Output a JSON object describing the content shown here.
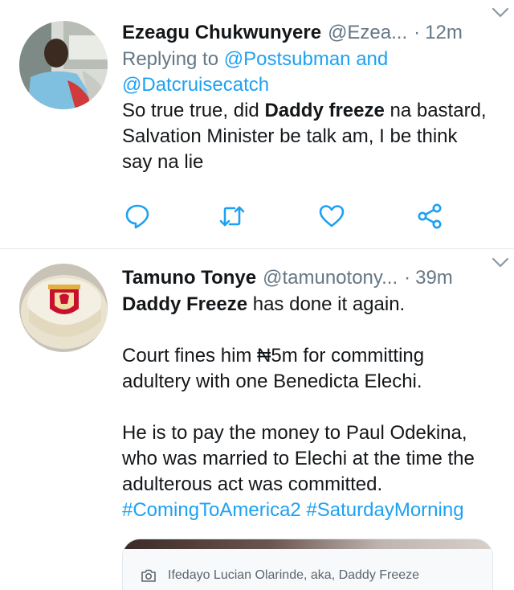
{
  "tweets": [
    {
      "name": "Ezeagu Chukwunyere",
      "handle": "@Ezea...",
      "time": "12m",
      "replying_prefix": "Replying to ",
      "replying_to_1": "@Postsubman and",
      "replying_to_2": "@Datcruisecatch",
      "text_parts": [
        "So true true, did ",
        "Daddy freeze",
        " na bastard,",
        "Salvation Minister be talk am, I be think",
        "say na lie"
      ],
      "actions": [
        "reply-icon",
        "retweet-icon",
        "like-icon",
        "share-icon"
      ]
    },
    {
      "name": "Tamuno Tonye",
      "handle": "@tamunotony...",
      "time": "39m",
      "p1_bold": "Daddy Freeze",
      "p1_rest": " has done it again.",
      "p2_line1": "Court fines him ₦5m for committing",
      "p2_line2": "adultery with one Benedicta Elechi.",
      "p3_line1": "He is to pay the money to Paul Odekina,",
      "p3_line2": "who was married to Elechi at the time the",
      "p3_line3": "adulterous act was committed.",
      "hashtags": "#ComingToAmerica2 #SaturdayMorning",
      "media_caption": "Ifedayo Lucian Olarinde, aka, Daddy Freeze"
    }
  ],
  "colors": {
    "accent": "#1da1f2",
    "secondary_text": "#657786",
    "divider": "#e1e8ed"
  }
}
